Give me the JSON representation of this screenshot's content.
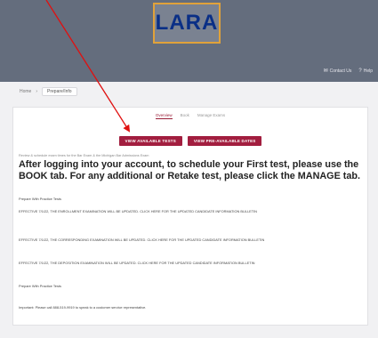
{
  "header": {
    "logo_text": "LARA",
    "contact_label": "Contact Us",
    "help_label": "Help",
    "colors": {
      "bar": "#646d7d",
      "logo_border": "#e0a23a",
      "logo_text": "#0a2f86"
    }
  },
  "breadcrumb": {
    "home_label": "Home",
    "current_label": "Prepare/Info"
  },
  "tabs": [
    "Overview",
    "Book",
    "Manage Exams"
  ],
  "buttons": {
    "view_available_tests": "VIEW AVAILABLE TESTS",
    "view_pre_available_dates": "VIEW PRE-AVAILABLE DATES"
  },
  "small_note": "Review & schedule exam times for the Bar Exam & the Michigan Bar Admissions Exam",
  "headline": "After logging into your account, to schedule your First test, please use the BOOK tab. For any additional or Retake test, please click the MANAGE tab.",
  "paragraphs": [
    "Prepare With Practice Tests",
    "EFFECTIVE 7/1/22, THE ENROLLMENT EXAMINATION WILL BE UPDATED. CLICK HERE FOR THE UPDATED CANDIDATE INFORMATION BULLETIN",
    "EFFECTIVE 7/1/22, THE CORRESPONDING EXAMINATION WILL BE UPDATED. CLICK HERE FOR THE UPDATED CANDIDATE INFORMATION BULLETIN",
    "EFFECTIVE 7/1/22, THE DEPOSITION EXAMINATION WILL BE UPDATED. CLICK HERE FOR THE UPDATED CANDIDATE INFORMATION BULLETIN",
    "Prepare With Practice Tests",
    "Important: Please call 888-519-9919 to speak to a customer service representative."
  ],
  "colors": {
    "button": "#a21e3f",
    "annotation_arrow": "#e01010"
  }
}
